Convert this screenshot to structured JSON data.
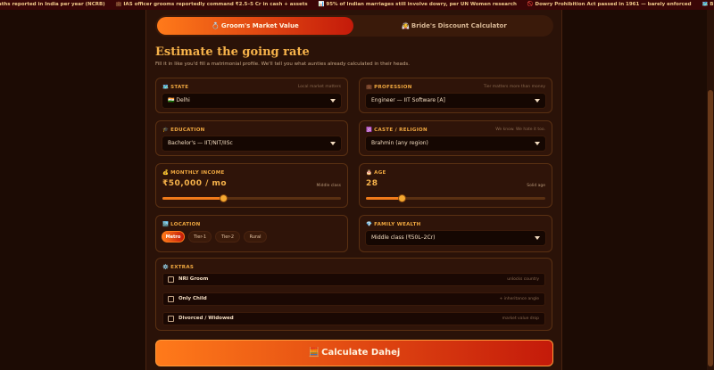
{
  "ticker": [
    "aths reported in India per year (NCRB)",
    "💼 IAS officer grooms reportedly command ₹2.5–5 Cr in cash + assets",
    "📊 95% of Indian marriages still involve dowry, per UN Women research",
    "🚫 Dowry Prohibition Act passed in 1961 — barely enforced",
    "🗺️ Bihar, UP, Haryana lead in"
  ],
  "tabs": {
    "groom": {
      "icon": "💍",
      "label": "Groom's Market Value"
    },
    "bride": {
      "icon": "👰",
      "label": "Bride's Discount Calculator"
    }
  },
  "heading": "Estimate the going rate",
  "subtext": "Fill it in like you'd fill a matrimonial profile. We'll tell you what aunties already calculated in their heads.",
  "state": {
    "icon": "🗺️",
    "label": "STATE",
    "hint": "Local market matters",
    "value": "🇮🇳 Delhi"
  },
  "profession": {
    "icon": "💼",
    "label": "PROFESSION",
    "hint": "Tier matters more than money",
    "value": "Engineer — IIT Software [A]"
  },
  "education": {
    "icon": "🎓",
    "label": "EDUCATION",
    "value": "Bachelor's — IIT/NIT/IISc"
  },
  "caste": {
    "icon": "🕉️",
    "label": "CASTE / RELIGION",
    "hint": "We know. We hate it too.",
    "value": "Brahmin (any region)"
  },
  "income": {
    "icon": "💰",
    "label": "MONTHLY INCOME",
    "value": "₹50,000 / mo",
    "note": "Middle class",
    "level": 0.34
  },
  "age": {
    "icon": "🎂",
    "label": "AGE",
    "value": "28",
    "note": "Solid age",
    "level": 0.2
  },
  "location": {
    "icon": "🏙️",
    "label": "LOCATION",
    "options": [
      "Metro",
      "Tier-1",
      "Tier-2",
      "Rural"
    ],
    "selected": "Metro"
  },
  "wealth": {
    "icon": "💎",
    "label": "FAMILY WEALTH",
    "value": "Middle class (₹50L–2Cr)"
  },
  "extras": {
    "icon": "⚙️",
    "label": "EXTRAS",
    "items": [
      {
        "label": "NRI Groom",
        "note": "unlocks country"
      },
      {
        "label": "Only Child",
        "note": "+ inheritance angle"
      },
      {
        "label": "Divorced / Widowed",
        "note": "market value drop"
      }
    ]
  },
  "cta": {
    "icon": "🧮",
    "label": "Calculate Dahej"
  }
}
